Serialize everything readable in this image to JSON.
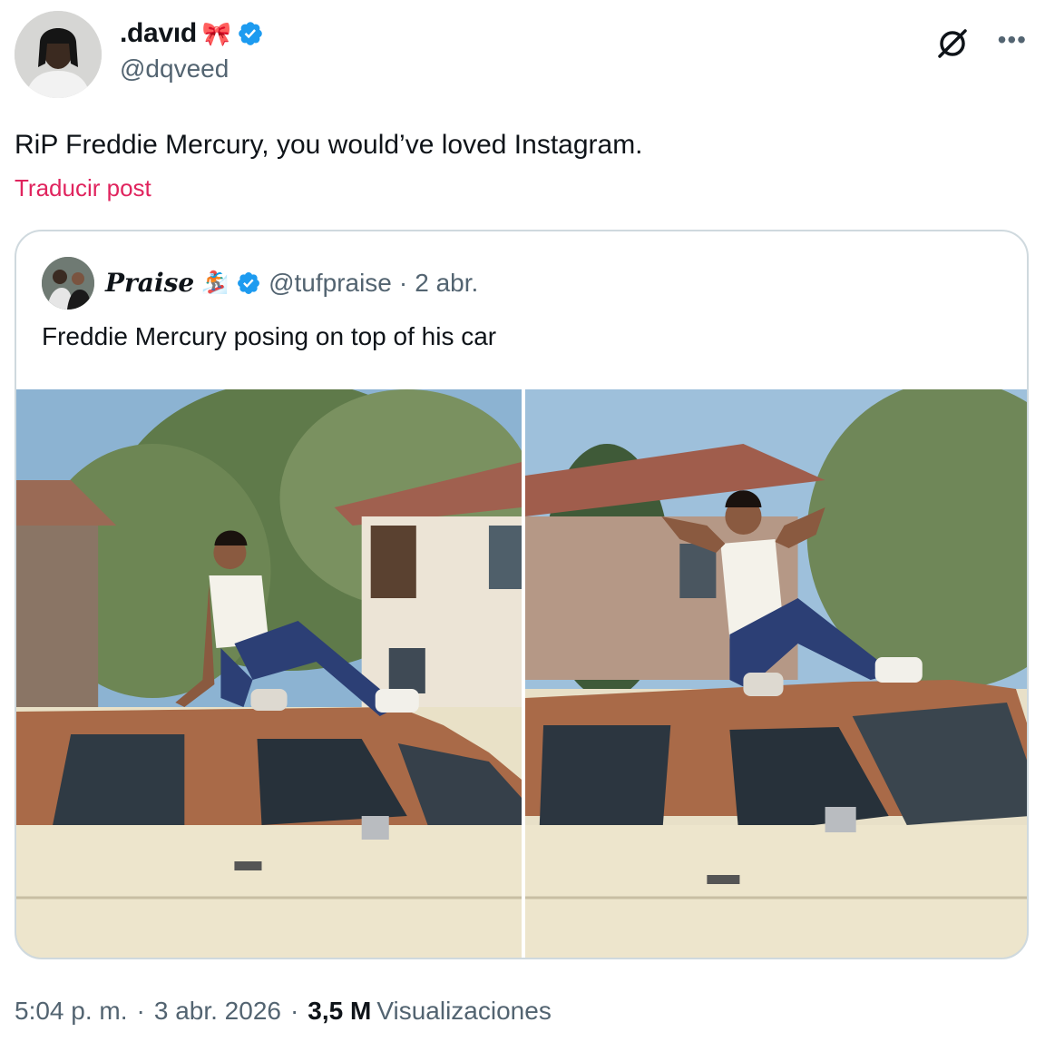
{
  "author": {
    "display_name": ".davıd",
    "name_emoji": "🎀",
    "handle": "@dqveed",
    "verified": true
  },
  "post": {
    "text": "RiP Freddie Mercury, you would’ve loved Instagram.",
    "translate_label": "Traducir post"
  },
  "quoted": {
    "display_name": "Praise",
    "name_emoji": "🏂",
    "verified": true,
    "handle": "@tufpraise",
    "separator": "·",
    "date": "2 abr.",
    "text": "Freddie Mercury posing on top of his car",
    "media_count": 2
  },
  "meta": {
    "time": "5:04 p. m.",
    "separator": "·",
    "date": "3 abr. 2026",
    "views_count": "3,5 M",
    "views_label": "Visualizaciones"
  },
  "icons": {
    "verified": "verified-badge-icon",
    "grok": "grok-icon",
    "more": "more-icon"
  },
  "colors": {
    "verified_blue": "#1d9bf0",
    "translate_pink": "#e0245e",
    "secondary_text": "#536471",
    "border": "#cfd9de"
  }
}
